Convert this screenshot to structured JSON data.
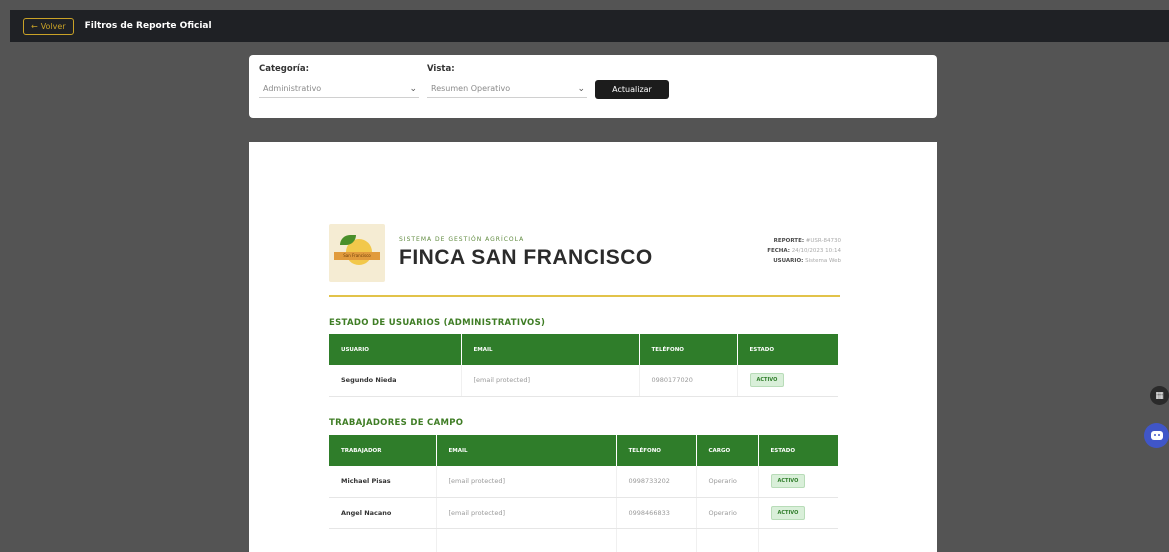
{
  "topbar": {
    "back_label": "Volver",
    "title": "Filtros de Reporte Oficial"
  },
  "filters": {
    "category_label": "Categoría:",
    "category_value": "Administrativo",
    "view_label": "Vista:",
    "view_value": "Resumen Operativo",
    "update_label": "Actualizar"
  },
  "report": {
    "system_label": "SISTEMA DE GESTIÓN AGRÍCOLA",
    "farm_name": "FINCA SAN FRANCISCO",
    "logo_text": "San Francisco",
    "meta": [
      {
        "key": "REPORTE:",
        "value": "#USR-84730"
      },
      {
        "key": "FECHA:",
        "value": "24/10/2023 10:14"
      },
      {
        "key": "USUARIO:",
        "value": "Sistema Web"
      }
    ]
  },
  "users_section": {
    "title": "ESTADO DE USUARIOS (ADMINISTRATIVOS)",
    "headers": [
      "USUARIO",
      "EMAIL",
      "TELÉFONO",
      "ESTADO"
    ],
    "rows": [
      {
        "user": "Segundo Nieda",
        "email": "[email protected]",
        "phone": "0980177020",
        "status": "ACTIVO"
      }
    ]
  },
  "workers_section": {
    "title": "TRABAJADORES DE CAMPO",
    "headers": [
      "TRABAJADOR",
      "EMAIL",
      "TELÉFONO",
      "CARGO",
      "ESTADO"
    ],
    "rows": [
      {
        "name": "Michael Pisas",
        "email": "[email protected]",
        "phone": "0998733202",
        "role": "Operario",
        "status": "ACTIVO"
      },
      {
        "name": "Angel Nacano",
        "email": "[email protected]",
        "phone": "0998466833",
        "role": "Operario",
        "status": "ACTIVO"
      },
      {
        "name": "",
        "email": "",
        "phone": "",
        "role": "",
        "status": ""
      }
    ]
  },
  "colors": {
    "primary_green": "#2f7d2a",
    "gold": "#e2c34a",
    "topbar": "#1f2125",
    "fab_blue": "#4056c8"
  },
  "icons": {
    "back": "arrow-left-icon",
    "chevron": "chevron-down-icon",
    "fab1": "grid-icon",
    "fab2": "chat-bot-icon"
  }
}
